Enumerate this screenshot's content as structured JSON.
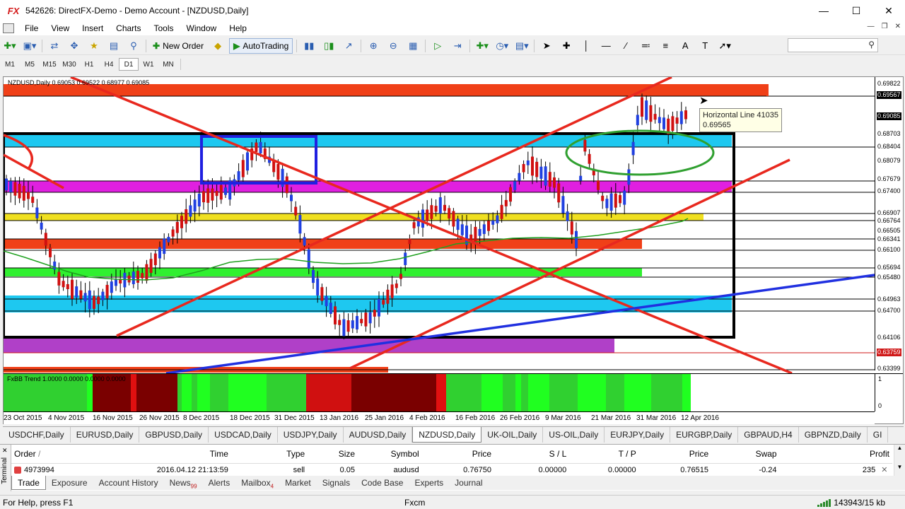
{
  "window": {
    "logo": "FX",
    "title": "542626: DirectFX-Demo - Demo Account - [NZDUSD,Daily]",
    "minimize_icon": "minimize-icon",
    "maximize_icon": "maximize-icon",
    "close_icon": "close-icon"
  },
  "menu": {
    "items": [
      "File",
      "View",
      "Insert",
      "Charts",
      "Tools",
      "Window",
      "Help"
    ]
  },
  "toolbar": {
    "new_order_label": "New Order",
    "autotrading_label": "AutoTrading"
  },
  "timeframes": {
    "items": [
      "M1",
      "M5",
      "M15",
      "M30",
      "H1",
      "H4",
      "D1",
      "W1",
      "MN"
    ],
    "active": "D1"
  },
  "chart": {
    "header": "NZDUSD,Daily  0.69053 0.69522 0.68977 0.69085",
    "indicator_label": "FxBB Trend 1.0000 0.0000 0.0000 0.0000",
    "indicator_axis_top": "1",
    "indicator_axis_bottom": "0",
    "tooltip_title": "Horizontal Line 41035",
    "tooltip_value": "0.69565",
    "price_labels": [
      "0.69822",
      "0.69567",
      "0.69085",
      "0.68703",
      "0.68404",
      "0.68079",
      "0.67679",
      "0.67400",
      "0.66907",
      "0.66764",
      "0.66505",
      "0.66341",
      "0.66100",
      "0.65694",
      "0.65480",
      "0.64963",
      "0.64700",
      "0.64106",
      "0.63759",
      "0.63399"
    ],
    "date_labels": [
      "23 Oct 2015",
      "4 Nov 2015",
      "16 Nov 2015",
      "26 Nov 2015",
      "8 Dec 2015",
      "18 Dec 2015",
      "31 Dec 2015",
      "13 Jan 2016",
      "25 Jan 2016",
      "4 Feb 2016",
      "16 Feb 2016",
      "26 Feb 2016",
      "9 Mar 2016",
      "21 Mar 2016",
      "31 Mar 2016",
      "12 Apr 2016"
    ]
  },
  "symbol_tabs": {
    "items": [
      "USDCHF,Daily",
      "EURUSD,Daily",
      "GBPUSD,Daily",
      "USDCAD,Daily",
      "USDJPY,Daily",
      "AUDUSD,Daily",
      "NZDUSD,Daily",
      "UK-OIL,Daily",
      "US-OIL,Daily",
      "EURJPY,Daily",
      "EURGBP,Daily",
      "GBPAUD,H4",
      "GBPNZD,Daily",
      "GI"
    ],
    "active": "NZDUSD,Daily"
  },
  "terminal": {
    "side_label": "Terminal",
    "columns": [
      "Order",
      "Time",
      "Type",
      "Size",
      "Symbol",
      "Price",
      "S / L",
      "T / P",
      "Price",
      "Swap",
      "Profit"
    ],
    "sort_mark": "/",
    "rows": [
      {
        "order": "4973994",
        "time": "2016.04.12 21:13:59",
        "type": "sell",
        "size": "0.05",
        "symbol": "audusd",
        "price": "0.76750",
        "sl": "0.00000",
        "tp": "0.00000",
        "price2": "0.76515",
        "swap": "-0.24",
        "profit": "235"
      }
    ],
    "tabs": [
      "Trade",
      "Exposure",
      "Account History",
      "News",
      "Alerts",
      "Mailbox",
      "Market",
      "Signals",
      "Code Base",
      "Experts",
      "Journal"
    ],
    "news_count": "99",
    "mailbox_count": "4",
    "active_tab": "Trade"
  },
  "status": {
    "help": "For Help, press F1",
    "profile": "Fxcm",
    "connection": "143943/15 kb"
  },
  "colors": {
    "accent_red": "#e8281e",
    "zone_cyan": "#1ec8f0",
    "zone_magenta": "#e020e0",
    "zone_yellow": "#f0e020",
    "zone_orange": "#f04018",
    "zone_green": "#30f030",
    "zone_purple": "#b040c8",
    "bull_candle": "#2040e0",
    "bear_candle": "#d01010"
  }
}
